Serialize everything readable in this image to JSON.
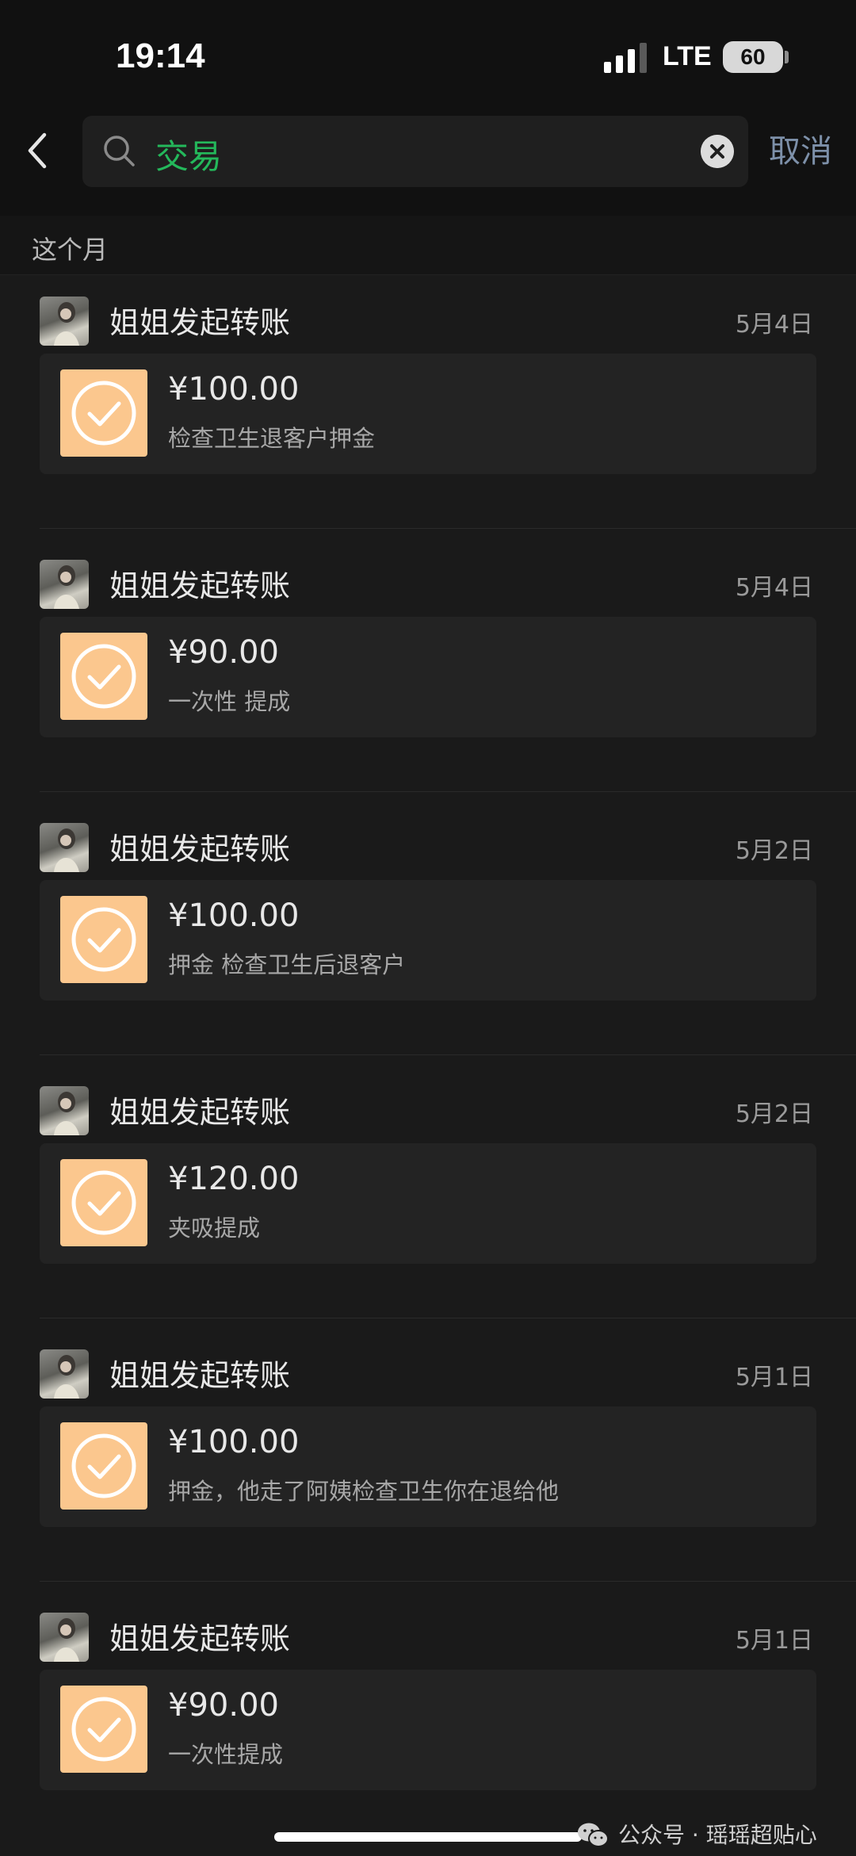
{
  "status_bar": {
    "time": "19:14",
    "network": "LTE",
    "battery": "60"
  },
  "search": {
    "query": "交易",
    "cancel_label": "取消",
    "query_color": "#24b85b"
  },
  "section": {
    "title": "这个月"
  },
  "records": [
    {
      "sender": "姐姐发起转账",
      "date": "5月4日",
      "amount": "¥100.00",
      "note": "检查卫生退客户押金"
    },
    {
      "sender": "姐姐发起转账",
      "date": "5月4日",
      "amount": "¥90.00",
      "note": "一次性 提成"
    },
    {
      "sender": "姐姐发起转账",
      "date": "5月2日",
      "amount": "¥100.00",
      "note": "押金 检查卫生后退客户"
    },
    {
      "sender": "姐姐发起转账",
      "date": "5月2日",
      "amount": "¥120.00",
      "note": "夹吸提成"
    },
    {
      "sender": "姐姐发起转账",
      "date": "5月1日",
      "amount": "¥100.00",
      "note": "押金，他走了阿姨检查卫生你在退给他"
    },
    {
      "sender": "姐姐发起转账",
      "date": "5月1日",
      "amount": "¥90.00",
      "note": "一次性提成"
    }
  ],
  "watermark": {
    "text": "公众号 · 瑶瑶超贴心",
    "icon": "wechat-icon"
  },
  "colors": {
    "card_icon": "#fbc78e",
    "cancel": "#7d90a9"
  }
}
